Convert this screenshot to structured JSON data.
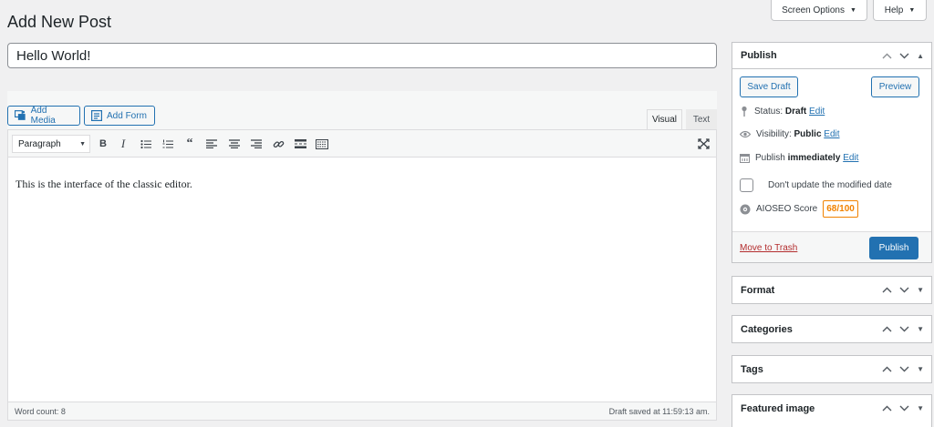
{
  "page": {
    "title": "Add New Post"
  },
  "top_buttons": {
    "screen_options": "Screen Options",
    "help": "Help"
  },
  "post": {
    "title_value": "Hello World!"
  },
  "editor": {
    "add_media": "Add Media",
    "add_form": "Add Form",
    "tab_visual": "Visual",
    "tab_text": "Text",
    "format_select": "Paragraph",
    "content": "This is the interface of the classic editor.",
    "word_count": "Word count: 8",
    "draft_saved": "Draft saved at 11:59:13 am.",
    "toolbar_icons": [
      "bold-icon",
      "italic-icon",
      "bullet-list-icon",
      "numbered-list-icon",
      "blockquote-icon",
      "align-left-icon",
      "align-center-icon",
      "align-right-icon",
      "link-icon",
      "read-more-icon",
      "toolbar-toggle-icon",
      "fullscreen-icon"
    ]
  },
  "publish_box": {
    "title": "Publish",
    "save_draft": "Save Draft",
    "preview": "Preview",
    "status_label": "Status:",
    "status_value": "Draft",
    "visibility_label": "Visibility:",
    "visibility_value": "Public",
    "publish_label": "Publish",
    "publish_value": "immediately",
    "edit": "Edit",
    "dont_update": "Don't update the modified date",
    "aioseo_label": "AIOSEO Score",
    "aioseo_score": "68/100",
    "move_to_trash": "Move to Trash",
    "publish_button": "Publish"
  },
  "boxes": {
    "format": "Format",
    "categories": "Categories",
    "tags": "Tags",
    "featured_image": "Featured image"
  },
  "colors": {
    "accent": "#2271b1",
    "trash": "#b32d2e",
    "score": "#f18200",
    "background": "#f0f0f1"
  }
}
